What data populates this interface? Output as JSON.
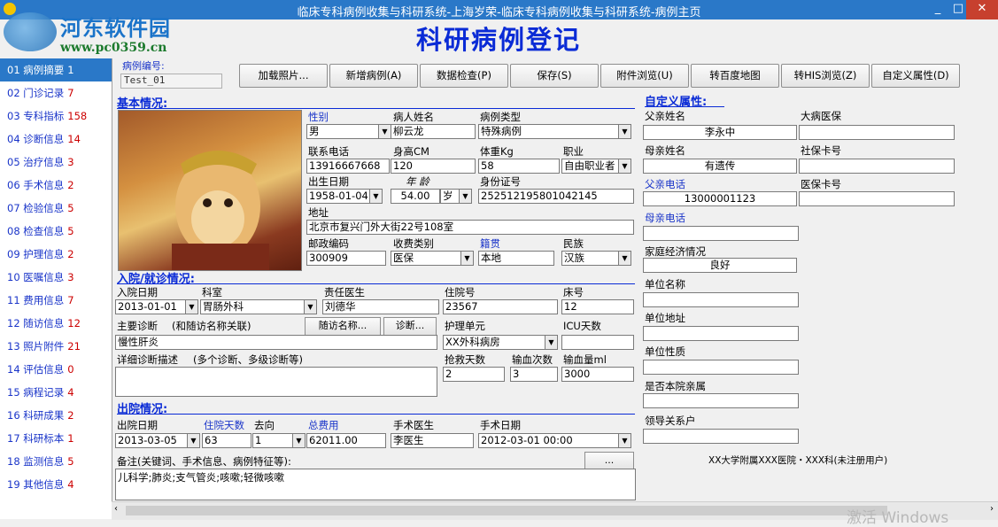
{
  "window": {
    "title": "临床专科病例收集与科研系统-上海岁荣-临床专科病例收集与科研系统-病例主页",
    "min": "_",
    "max": "□",
    "close": "✕"
  },
  "watermark": {
    "name": "河东软件园",
    "url": "www.pc0359.cn"
  },
  "header": {
    "title": "科研病例登记"
  },
  "sidebar": {
    "items": [
      {
        "label": "01 病例摘要",
        "count": "1"
      },
      {
        "label": "02 门诊记录",
        "count": "7"
      },
      {
        "label": "03 专科指标",
        "count": "158"
      },
      {
        "label": "04 诊断信息",
        "count": "14"
      },
      {
        "label": "05 治疗信息",
        "count": "3"
      },
      {
        "label": "06 手术信息",
        "count": "2"
      },
      {
        "label": "07 检验信息",
        "count": "5"
      },
      {
        "label": "08 检查信息",
        "count": "5"
      },
      {
        "label": "09 护理信息",
        "count": "2"
      },
      {
        "label": "10 医嘱信息",
        "count": "3"
      },
      {
        "label": "11 费用信息",
        "count": "7"
      },
      {
        "label": "12 随访信息",
        "count": "12"
      },
      {
        "label": "13 照片附件",
        "count": "21"
      },
      {
        "label": "14 评估信息",
        "count": "0"
      },
      {
        "label": "15 病程记录",
        "count": "4"
      },
      {
        "label": "16 科研成果",
        "count": "2"
      },
      {
        "label": "17 科研标本",
        "count": "1"
      },
      {
        "label": "18 监测信息",
        "count": "5"
      },
      {
        "label": "19 其他信息",
        "count": "4"
      }
    ]
  },
  "case_id": {
    "label": "病例编号:",
    "value": "Test_01"
  },
  "toolbar": {
    "load_photo": "加载照片...",
    "new_case": "新增病例(A)",
    "data_check": "数据检查(P)",
    "save": "保存(S)",
    "attachments": "附件浏览(U)",
    "baidu_map": "转百度地图",
    "his": "转HIS浏览(Z)",
    "custom_attr": "自定义属性(D)"
  },
  "basic": {
    "title": "基本情况:",
    "gender": {
      "label": "性别",
      "value": "男"
    },
    "patient_name": {
      "label": "病人姓名",
      "value": "柳云龙"
    },
    "case_type": {
      "label": "病例类型",
      "value": "特殊病例"
    },
    "phone": {
      "label": "联系电话",
      "value": "13916667668"
    },
    "height": {
      "label": "身高CM",
      "value": "120"
    },
    "weight": {
      "label": "体重Kg",
      "value": "58"
    },
    "occupation": {
      "label": "职业",
      "value": "自由职业者"
    },
    "birth": {
      "label": "出生日期",
      "value": "1958-01-04"
    },
    "age": {
      "label": "年 龄",
      "value": "54.00",
      "unit": "岁"
    },
    "id_number": {
      "label": "身份证号",
      "value": "252512195801042145"
    },
    "address": {
      "label": "地址",
      "value": "北京市复兴门外大街22号108室"
    },
    "postcode": {
      "label": "邮政编码",
      "value": "300909"
    },
    "fee_type": {
      "label": "收费类别",
      "value": "医保"
    },
    "native": {
      "label": "籍贯",
      "value": "本地"
    },
    "ethnicity": {
      "label": "民族",
      "value": "汉族"
    }
  },
  "admission": {
    "title": "入院/就诊情况:",
    "date": {
      "label": "入院日期",
      "value": "2013-01-01"
    },
    "dept": {
      "label": "科室",
      "value": "胃肠外科"
    },
    "doctor": {
      "label": "责任医生",
      "value": "刘德华"
    },
    "inpatient_no": {
      "label": "住院号",
      "value": "23567"
    },
    "bed": {
      "label": "床号",
      "value": "12"
    },
    "main_diag": {
      "label": "主要诊断",
      "note": "(和随访名称关联)",
      "value": "慢性肝炎"
    },
    "followup_btn": "随访名称...",
    "diag_btn": "诊断...",
    "nursing_unit": {
      "label": "护理单元",
      "value": "XX外科病房"
    },
    "icu_days": {
      "label": "ICU天数",
      "value": ""
    },
    "detail_diag": {
      "label": "详细诊断描述",
      "note": "(多个诊断、多级诊断等)",
      "value": ""
    },
    "rescue_days": {
      "label": "抢救天数",
      "value": "2"
    },
    "transfusion_times": {
      "label": "输血次数",
      "value": "3"
    },
    "transfusion_ml": {
      "label": "输血量ml",
      "value": "3000"
    }
  },
  "discharge": {
    "title": "出院情况:",
    "date": {
      "label": "出院日期",
      "value": "2013-03-05"
    },
    "stay_days": {
      "label": "住院天数",
      "value": "63"
    },
    "destination": {
      "label": "去向",
      "value": "1"
    },
    "total_fee": {
      "label": "总费用",
      "value": "62011.00"
    },
    "surgeon": {
      "label": "手术医生",
      "value": "李医生"
    },
    "surgery_date": {
      "label": "手术日期",
      "value": "2012-03-01 00:00"
    },
    "remarks": {
      "label": "备注(关键词、手术信息、病例特征等):",
      "value": "儿科学;肺炎;支气管炎;咳嗽;轻微咳嗽"
    },
    "more_btn": "..."
  },
  "custom": {
    "title": "自定义属性:",
    "father_name": {
      "label": "父亲姓名",
      "value": "李永中"
    },
    "serious_insurance": {
      "label": "大病医保",
      "value": ""
    },
    "mother_name": {
      "label": "母亲姓名",
      "value": "有遗传"
    },
    "social_card": {
      "label": "社保卡号",
      "value": ""
    },
    "father_phone": {
      "label": "父亲电话",
      "value": "13000001123"
    },
    "medical_card": {
      "label": "医保卡号",
      "value": ""
    },
    "mother_phone": {
      "label": "母亲电话",
      "value": ""
    },
    "family_economy": {
      "label": "家庭经济情况",
      "value": "良好"
    },
    "work_name": {
      "label": "单位名称",
      "value": ""
    },
    "work_address": {
      "label": "单位地址",
      "value": ""
    },
    "work_nature": {
      "label": "单位性质",
      "value": ""
    },
    "staff_relative": {
      "label": "是否本院亲属",
      "value": ""
    },
    "leader_relation": {
      "label": "领导关系户",
      "value": ""
    }
  },
  "footer": {
    "note": "XX大学附属XXX医院・XXX科(未注册用户)"
  },
  "activation": {
    "text": "激活 Windows"
  }
}
